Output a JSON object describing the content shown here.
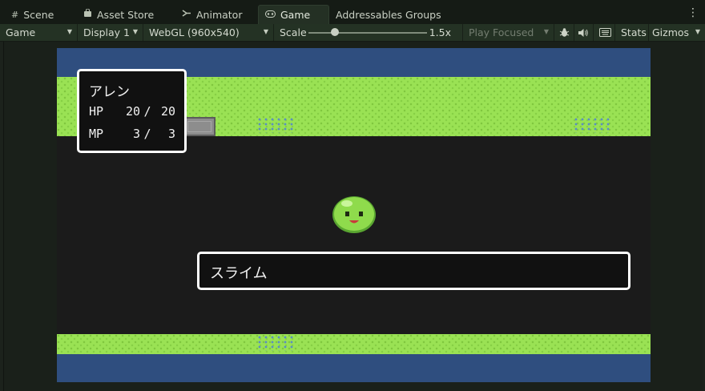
{
  "tabs": [
    {
      "label": "Scene",
      "icon": "grid-icon"
    },
    {
      "label": "Asset Store",
      "icon": "bag-icon"
    },
    {
      "label": "Animator",
      "icon": "animator-icon"
    },
    {
      "label": "Game",
      "icon": "gamepad-icon",
      "active": true
    },
    {
      "label": "Addressables Groups"
    }
  ],
  "toolbar": {
    "game_view_select": "Game",
    "display_select": "Display 1",
    "resolution_select": "WebGL (960x540)",
    "scale_label": "Scale",
    "scale_value": "1.5x",
    "scale_fraction": 0.22,
    "play_mode_select": "Play Focused",
    "stats_label": "Stats",
    "gizmos_label": "Gizmos"
  },
  "status": {
    "name": "アレン",
    "hp_label": "HP",
    "hp_current": "20",
    "hp_max": "20",
    "mp_label": "MP",
    "mp_current": "3",
    "mp_max": "3",
    "separator": "/"
  },
  "enemy": {
    "name": "スライム"
  },
  "colors": {
    "grass": "#9ae254",
    "water": "#2f4e7f",
    "slime": "#8fdb4c",
    "window_bg": "#111111",
    "window_border": "#ffffff"
  }
}
